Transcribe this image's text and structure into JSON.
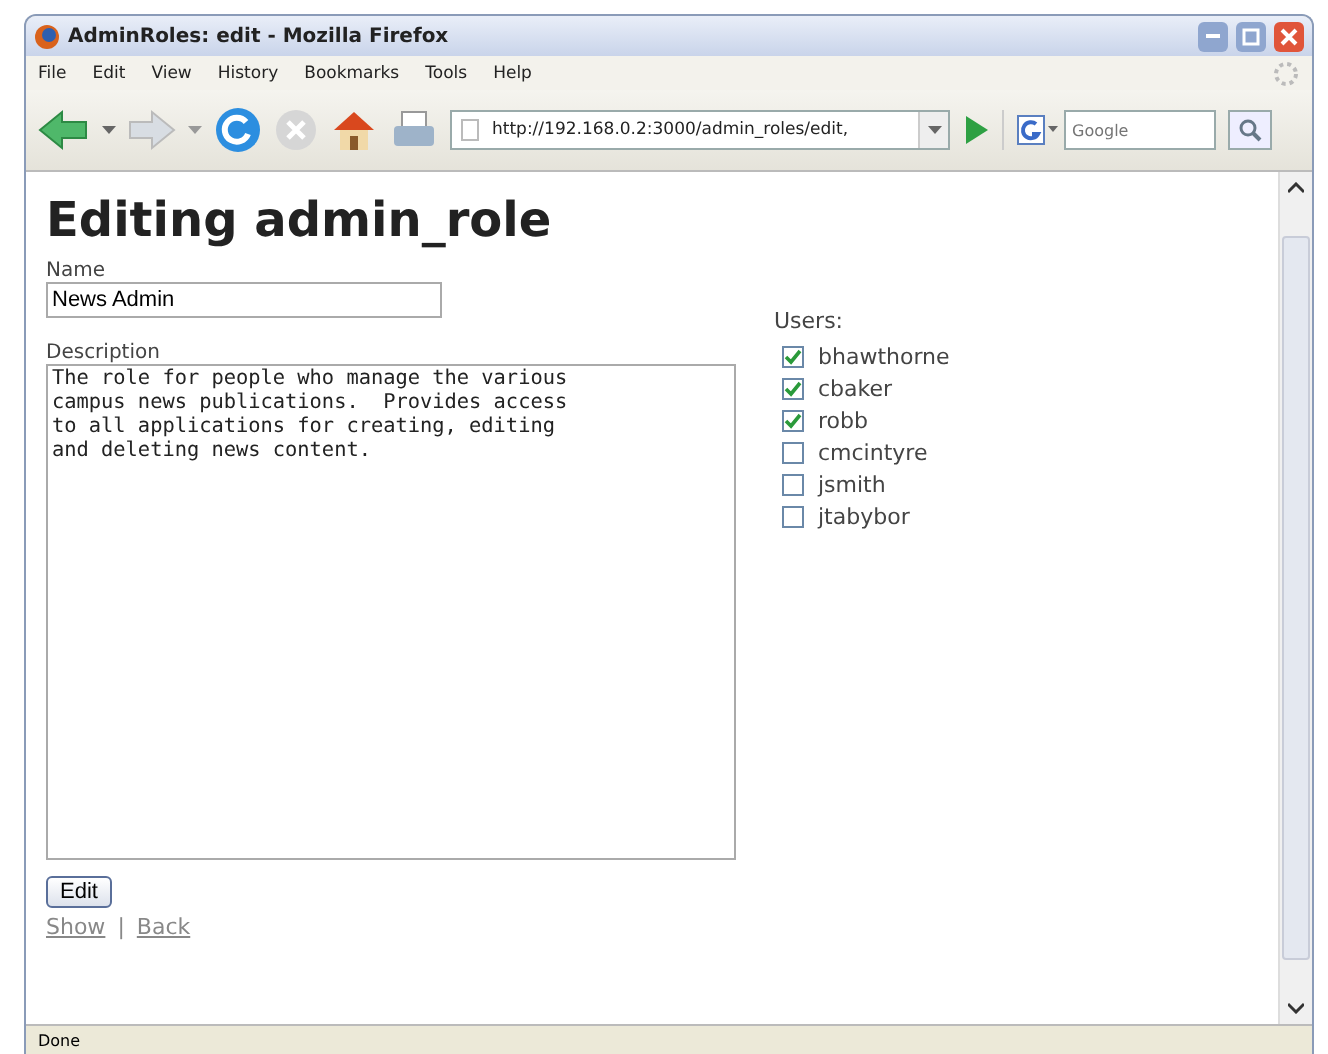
{
  "window": {
    "title": "AdminRoles: edit - Mozilla Firefox"
  },
  "menu": [
    "File",
    "Edit",
    "View",
    "History",
    "Bookmarks",
    "Tools",
    "Help"
  ],
  "address_bar": {
    "value": "http://192.168.0.2:3000/admin_roles/edit,"
  },
  "search": {
    "placeholder": "Google"
  },
  "page": {
    "heading": "Editing admin_role",
    "name_label": "Name",
    "name_value": "News Admin",
    "description_label": "Description",
    "description_value": "The role for people who manage the various\ncampus news publications.  Provides access\nto all applications for creating, editing\nand deleting news content.",
    "users_label": "Users:",
    "users": [
      {
        "name": "bhawthorne",
        "checked": true
      },
      {
        "name": "cbaker",
        "checked": true
      },
      {
        "name": "robb",
        "checked": true
      },
      {
        "name": "cmcintyre",
        "checked": false
      },
      {
        "name": "jsmith",
        "checked": false
      },
      {
        "name": "jtabybor",
        "checked": false
      }
    ],
    "submit": "Edit",
    "links": [
      "Show",
      "Back"
    ],
    "link_separator": "|"
  },
  "status_bar": "Done"
}
